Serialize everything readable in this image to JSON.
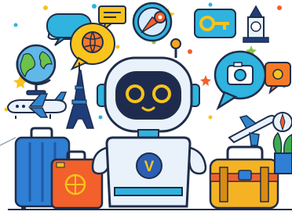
{
  "illustration": {
    "robot": {
      "emblem_letter": "V"
    },
    "colors": {
      "robot_body": "#e9f2fb",
      "robot_outline": "#1f2d4a",
      "robot_face": "#1e2b4f",
      "robot_eye": "#f7c31c",
      "robot_emblem": "#2b5fb5",
      "antenna_ball": "#f6a51e",
      "suitcase_blue": "#2f7fd4",
      "suitcase_orange": "#f2602b",
      "bag_yellow": "#f5b323",
      "bubble_teal": "#2fb3df",
      "bubble_yellow": "#f7c91f",
      "bubble_orange": "#f47a28",
      "plane_blue": "#2e86cf",
      "tower_navy": "#1f3d7a",
      "plant_green": "#3aae4c",
      "confetti_colors": [
        "#f7c31c",
        "#2fb3df",
        "#f2602b",
        "#8bc34a"
      ]
    }
  }
}
